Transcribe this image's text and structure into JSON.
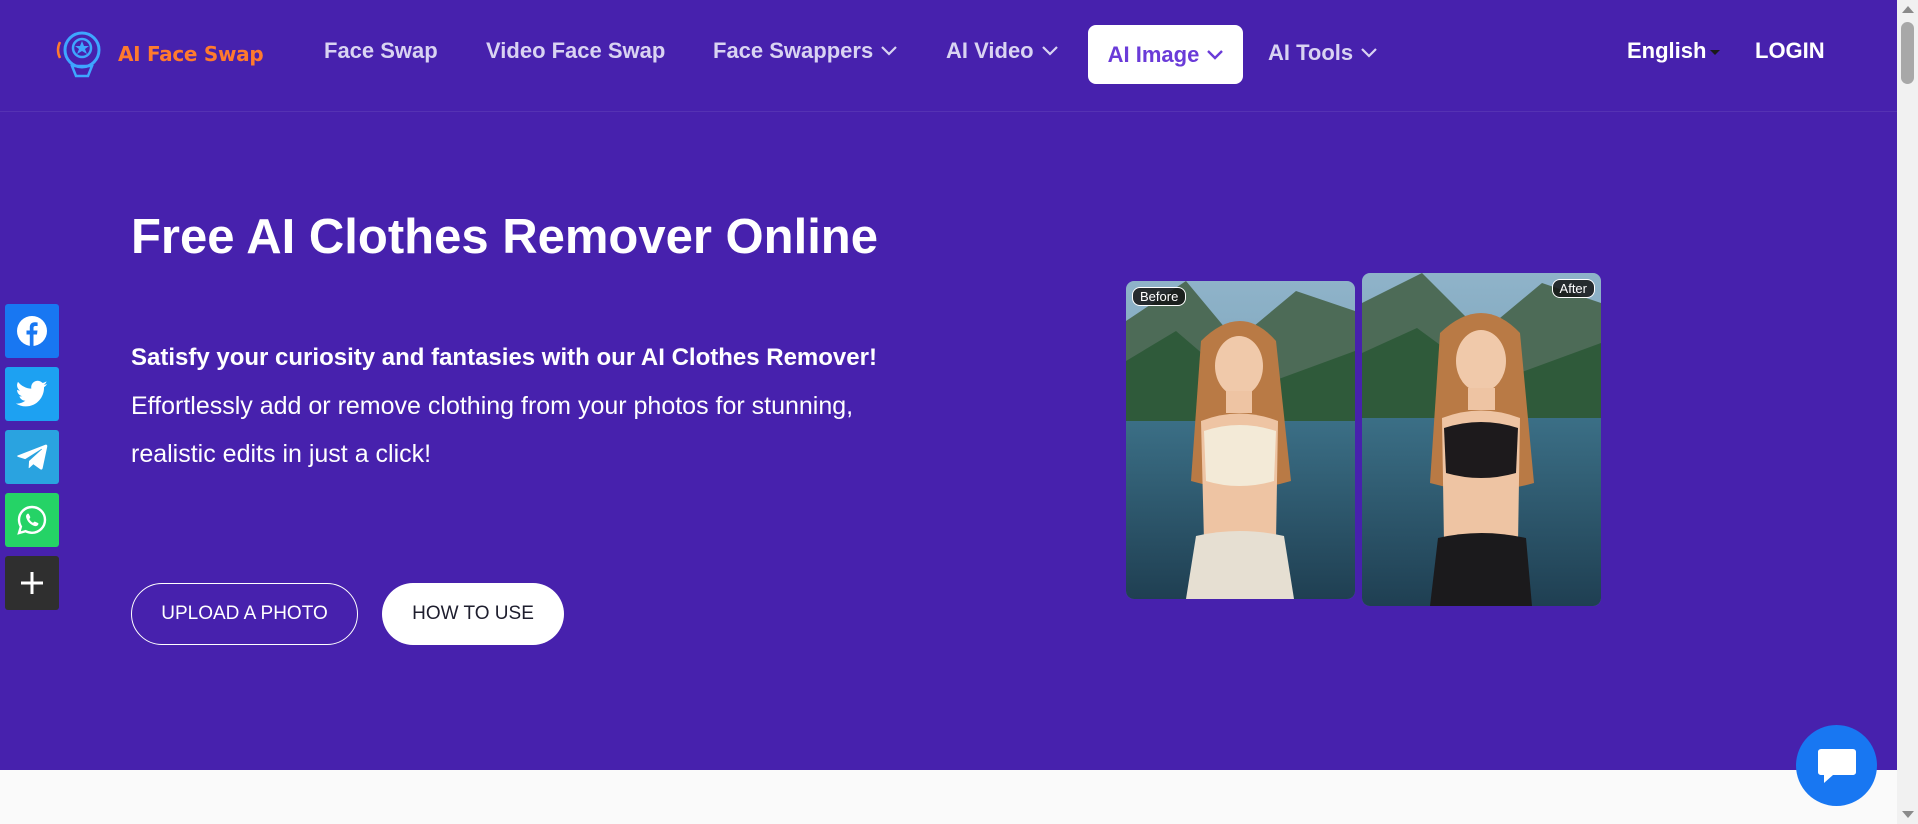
{
  "nav": {
    "logo_text": "AI Face Swap",
    "items": [
      {
        "label": "Face Swap"
      },
      {
        "label": "Video Face Swap"
      },
      {
        "label": "Face Swappers"
      },
      {
        "label": "AI Video"
      },
      {
        "label": "AI Image"
      },
      {
        "label": "AI Tools"
      }
    ],
    "language": "English",
    "login": "LOGIN"
  },
  "hero": {
    "title": "Free AI Clothes Remover Online",
    "subtitle_bold": "Satisfy your curiosity and fantasies with our AI Clothes Remover!",
    "subtitle_line1": "Effortlessly add or remove clothing from your photos for stunning,",
    "subtitle_line2": "realistic edits in just a click!",
    "upload_button": "UPLOAD A PHOTO",
    "howto_button": "HOW TO USE"
  },
  "comparison": {
    "before_label": "Before",
    "after_label": "After"
  },
  "share": [
    "facebook-icon",
    "twitter-icon",
    "telegram-icon",
    "whatsapp-icon",
    "plus-icon"
  ],
  "colors": {
    "hero_bg": "#4721ad",
    "logo_orange": "#ff7a2e",
    "facebook": "#1877f2",
    "twitter": "#1da1f2",
    "telegram": "#2aa3e0",
    "whatsapp": "#25d366",
    "more": "#2f2f2f",
    "chat": "#1877f2"
  }
}
